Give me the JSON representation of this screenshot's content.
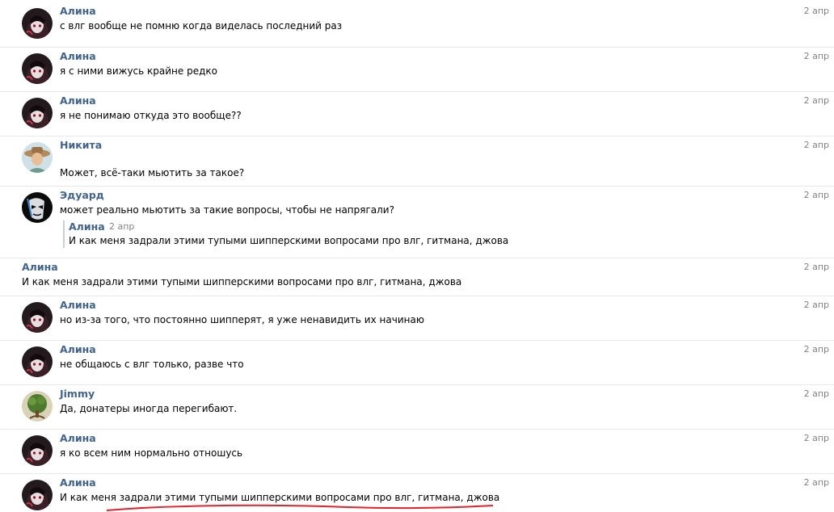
{
  "messages": [
    {
      "author": "Алина",
      "date": "2 апр",
      "text": "с влг вообще не помню когда виделась последний раз",
      "avatar": "alina"
    },
    {
      "author": "Алина",
      "date": "2 апр",
      "text": "я с ними вижусь крайне редко",
      "avatar": "alina"
    },
    {
      "author": "Алина",
      "date": "2 апр",
      "text": "я не понимаю откуда это вообще??",
      "avatar": "alina"
    },
    {
      "author": "Никита",
      "date": "2 апр",
      "text": "Может, всё-таки мьютить за такое?",
      "avatar": "nikita"
    },
    {
      "author": "Эдуард",
      "date": "2 апр",
      "text": "может реально мьютить за такие вопросы, чтобы не напрягали?",
      "avatar": "eduard",
      "quote": {
        "author": "Алина",
        "date": "2 апр",
        "text": "И как меня задрали этими тупыми шипперскими вопросами про влг, гитмана, джова"
      }
    },
    {
      "author": "Алина",
      "date": "2 апр",
      "text": "И как меня задрали этими тупыми шипперскими вопросами про влг, гитмана, джова",
      "avatar": ""
    },
    {
      "author": "Алина",
      "date": "2 апр",
      "text": "но из-за того, что постоянно шипперят, я уже ненавидить их начинаю",
      "avatar": "alina"
    },
    {
      "author": "Алина",
      "date": "2 апр",
      "text": "не общаюсь с влг только, разве что",
      "avatar": "alina"
    },
    {
      "author": "Jimmy",
      "date": "2 апр",
      "text": "Да, донатеры иногда перегибают.",
      "avatar": "jimmy"
    },
    {
      "author": "Алина",
      "date": "2 апр",
      "text": "я ко всем ним нормально отношусь",
      "avatar": "alina"
    },
    {
      "author": "Алина",
      "date": "2 апр",
      "text": "И как меня задрали этими тупыми шипперскими вопросами про влг, гитмана, джова",
      "avatar": "alina",
      "annotated": true
    }
  ],
  "colors": {
    "name": "#42648b",
    "date": "#828282",
    "separator": "#e7e8ec",
    "quote_bar": "#c5d0db",
    "annotation": "#e0242c"
  }
}
